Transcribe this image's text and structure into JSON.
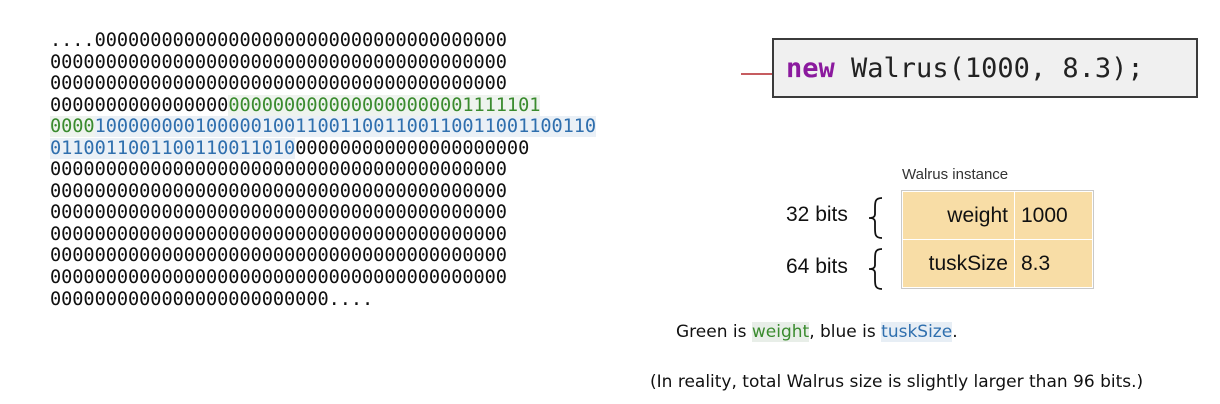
{
  "bits": {
    "lines": [
      [
        {
          "text": "....0000000000000000000000000000000000000",
          "c": "plain"
        }
      ],
      [
        {
          "text": "00000000000000000000000000000000000000000",
          "c": "plain"
        }
      ],
      [
        {
          "text": "00000000000000000000000000000000000000000",
          "c": "plain"
        }
      ],
      [
        {
          "text": "0000000000000000",
          "c": "plain"
        },
        {
          "text": "0000000000000000000001111101",
          "c": "green"
        }
      ],
      [
        {
          "text": "0000",
          "c": "green"
        },
        {
          "text": "100000000100000100110011001100110011001100110",
          "c": "blue"
        }
      ],
      [
        {
          "text": "011001100110011001",
          "c": "blue"
        },
        {
          "text": "1010",
          "c": "blue"
        },
        {
          "text": "000000000000000000000",
          "c": "plain"
        }
      ],
      [
        {
          "text": "00000000000000000000000000000000000000000",
          "c": "plain"
        }
      ],
      [
        {
          "text": "00000000000000000000000000000000000000000",
          "c": "plain"
        }
      ],
      [
        {
          "text": "00000000000000000000000000000000000000000",
          "c": "plain"
        }
      ],
      [
        {
          "text": "00000000000000000000000000000000000000000",
          "c": "plain"
        }
      ],
      [
        {
          "text": "00000000000000000000000000000000000000000",
          "c": "plain"
        }
      ],
      [
        {
          "text": "00000000000000000000000000000000000000000",
          "c": "plain"
        }
      ],
      [
        {
          "text": "0000000000000000000000000....",
          "c": "plain"
        }
      ]
    ]
  },
  "code": {
    "keyword": "new",
    "rest": " Walrus(1000, 8.3);"
  },
  "instance": {
    "title": "Walrus instance",
    "fields": [
      {
        "bits_label": "32 bits",
        "name": "weight",
        "value": "1000"
      },
      {
        "bits_label": "64 bits",
        "name": "tuskSize",
        "value": "8.3"
      }
    ]
  },
  "captions": {
    "line1_pre": "Green is ",
    "line1_green": "weight",
    "line1_mid": ", blue is ",
    "line1_blue": "tuskSize",
    "line1_post": ".",
    "line2": "(In reality, total Walrus size is slightly larger than 96 bits.)"
  },
  "colors": {
    "green": "#3a8b2e",
    "blue": "#2f6fae",
    "keyword": "#8b1a9e",
    "arrow": "#b3262c",
    "cell_fill": "#f8dda6"
  }
}
